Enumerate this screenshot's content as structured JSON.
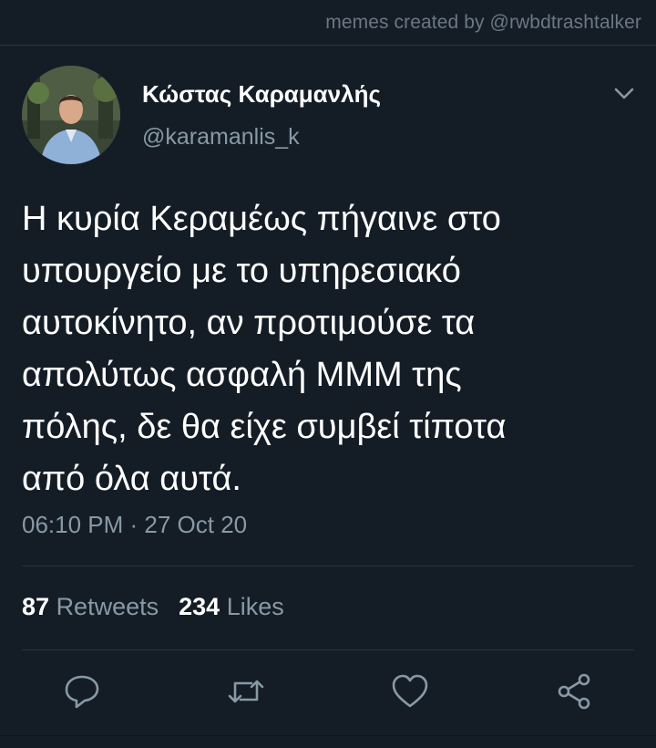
{
  "watermark": "memes created by @rwbdtrashtalker",
  "author": {
    "name": "Κώστας Καραμανλής",
    "handle": "@karamanlis_k"
  },
  "tweet": {
    "lines": [
      "Η κυρία Κεραμέως πήγαινε στο",
      "υπουργείο με το υπηρεσιακό",
      "αυτοκίνητο, αν προτιμούσε τα",
      "απολύτως ασφαλή ΜΜΜ της",
      "πόλης, δε θα είχε συμβεί τίποτα",
      "από όλα αυτά."
    ],
    "timestamp": "06:10 PM · 27 Oct 20"
  },
  "stats": {
    "retweets_count": "87",
    "retweets_label": "Retweets",
    "likes_count": "234",
    "likes_label": "Likes"
  },
  "icons": {
    "menu": "chevron-down-icon",
    "reply": "reply-icon",
    "retweet": "retweet-icon",
    "like": "heart-icon",
    "share": "share-icon"
  },
  "colors": {
    "background": "#141d26",
    "text": "#ffffff",
    "secondary": "#8899a6",
    "divider": "#2a3440"
  }
}
